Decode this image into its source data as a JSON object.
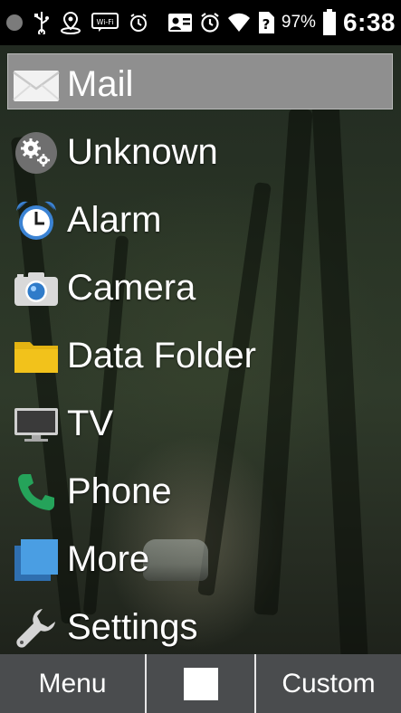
{
  "status_bar": {
    "battery_percent": "97%",
    "time": "6:38",
    "icons": [
      "dot-icon",
      "usb-icon",
      "location-icon",
      "wifi-box-icon",
      "alarm-small-icon",
      "contact-card-icon",
      "alarm-icon",
      "wifi-signal-icon",
      "no-sim-icon",
      "battery-icon"
    ]
  },
  "menu": {
    "items": [
      {
        "label": "Mail",
        "icon": "mail-icon",
        "selected": true
      },
      {
        "label": "Unknown",
        "icon": "gears-icon"
      },
      {
        "label": "Alarm",
        "icon": "alarm-clock-icon"
      },
      {
        "label": "Camera",
        "icon": "camera-icon"
      },
      {
        "label": "Data Folder",
        "icon": "folder-icon"
      },
      {
        "label": "TV",
        "icon": "tv-icon"
      },
      {
        "label": "Phone",
        "icon": "phone-icon"
      },
      {
        "label": "More",
        "icon": "more-icon"
      },
      {
        "label": "Settings",
        "icon": "wrench-icon"
      }
    ]
  },
  "softkeys": {
    "left": "Menu",
    "right": "Custom"
  },
  "colors": {
    "highlight": "#8f8f8f",
    "softkey_bar": "#4a4c4e",
    "alarm_blue": "#3b83d4",
    "folder_yellow": "#f2c21b",
    "phone_green": "#25a35a",
    "more_blue": "#4a9ee3"
  }
}
